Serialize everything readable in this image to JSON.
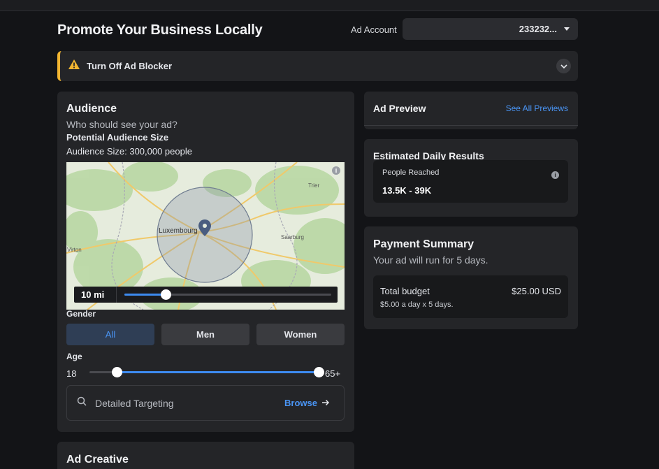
{
  "header": {
    "title": "Promote Your Business Locally",
    "ad_account_label": "Ad Account",
    "ad_account_value": "233232..."
  },
  "alert": {
    "text": "Turn Off Ad Blocker",
    "accent": "#f2b531"
  },
  "audience": {
    "title": "Audience",
    "subtitle": "Who should see your ad?",
    "potential_label": "Potential Audience Size",
    "size_text": "Audience Size: 300,000 people",
    "map": {
      "labels": {
        "center": "Luxembourg",
        "ne": "Trier",
        "se": "Saarburg",
        "w": "Virton"
      },
      "info": "i"
    },
    "radius": {
      "label": "10 mi",
      "fraction": 0.2
    },
    "gender": {
      "label": "Gender",
      "options": [
        "All",
        "Men",
        "Women"
      ],
      "selected": "All"
    },
    "age": {
      "label": "Age",
      "min": "18",
      "max": "65+",
      "selected_min_fraction": 0.12,
      "selected_max_fraction": 1.0
    },
    "targeting": {
      "placeholder": "Detailed Targeting",
      "browse_label": "Browse"
    }
  },
  "ad_creative": {
    "title": "Ad Creative"
  },
  "ad_preview": {
    "title": "Ad Preview",
    "link": "See All Previews"
  },
  "results": {
    "title": "Estimated Daily Results",
    "metric_label": "People Reached",
    "metric_value": "13.5K - 39K",
    "info": "i"
  },
  "payment": {
    "title": "Payment Summary",
    "subtitle": "Your ad will run for 5 days.",
    "total_label": "Total budget",
    "total_value": "$25.00 USD",
    "detail": "$5.00 a day x 5 days."
  },
  "colors": {
    "accent_blue": "#4a95f5",
    "slider_blue": "#3d8bf0",
    "card_bg": "#242528",
    "page_bg": "#131417"
  },
  "icons": [
    "warning-icon",
    "chevron-down-icon",
    "caret-down-icon",
    "map-pin-icon",
    "info-icon",
    "search-icon",
    "arrow-right-icon"
  ]
}
